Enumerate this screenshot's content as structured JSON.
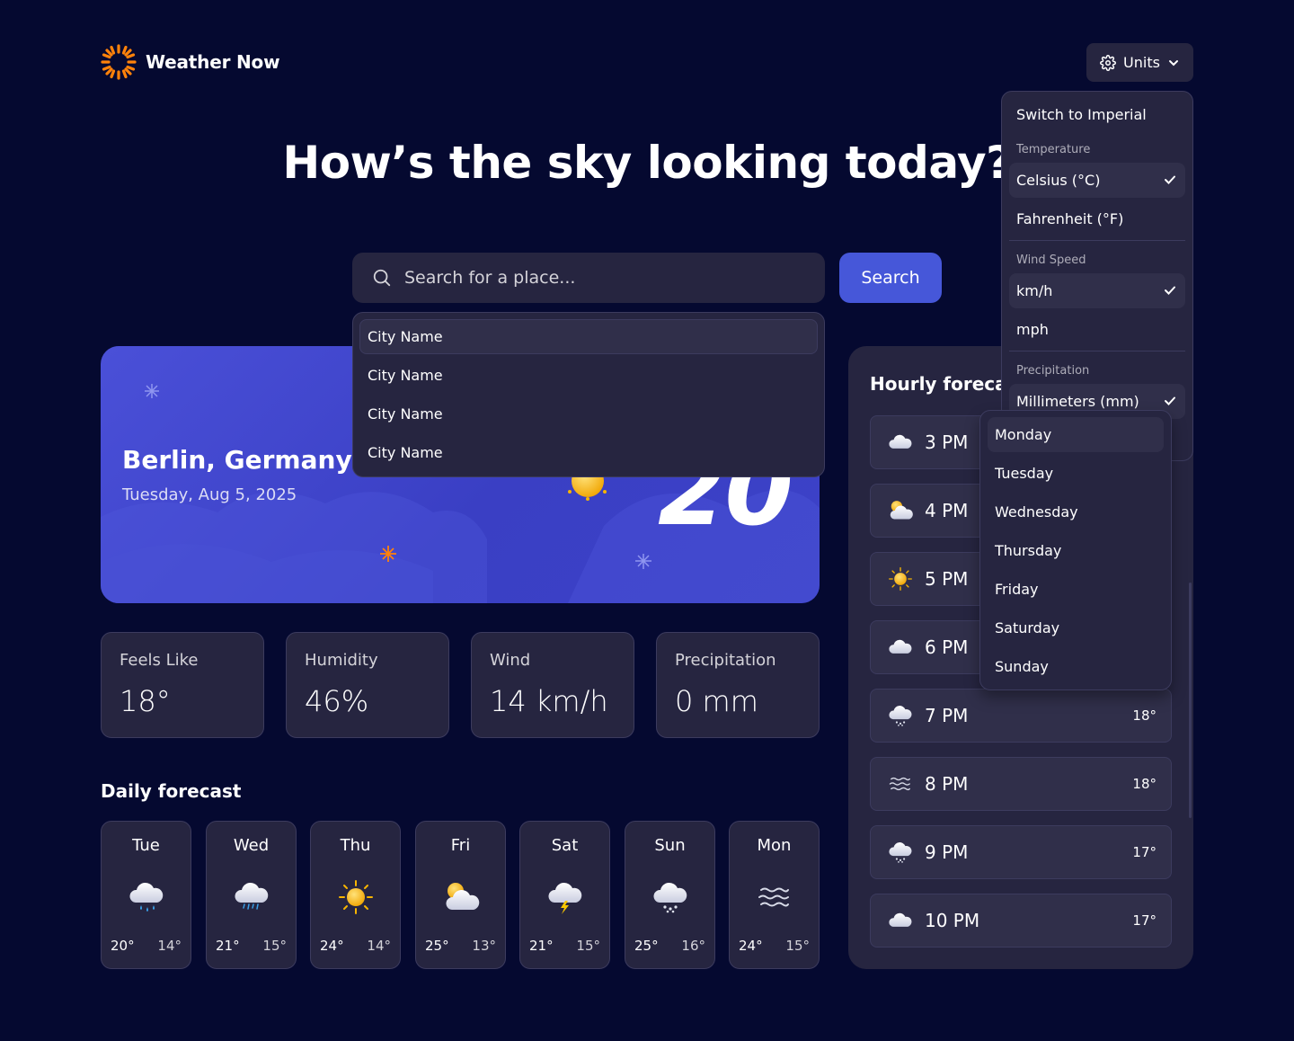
{
  "app": {
    "name": "Weather Now"
  },
  "header": {
    "units_label": "Units"
  },
  "hero": {
    "title": "How’s the sky looking today?"
  },
  "search": {
    "placeholder": "Search for a place...",
    "button_label": "Search",
    "suggestions": [
      "City Name",
      "City Name",
      "City Name",
      "City Name"
    ]
  },
  "current": {
    "location": "Berlin, Germany",
    "date": "Tuesday, Aug 5, 2025",
    "temperature": "20"
  },
  "stats": [
    {
      "label": "Feels Like",
      "value": "18°"
    },
    {
      "label": "Humidity",
      "value": "46%"
    },
    {
      "label": "Wind",
      "value": "14 km/h"
    },
    {
      "label": "Precipitation",
      "value": "0 mm"
    }
  ],
  "daily": {
    "title": "Daily forecast",
    "days": [
      {
        "day": "Tue",
        "icon": "rain-icon",
        "high": "20°",
        "low": "14°"
      },
      {
        "day": "Wed",
        "icon": "drizzle-icon",
        "high": "21°",
        "low": "15°"
      },
      {
        "day": "Thu",
        "icon": "sun-icon",
        "high": "24°",
        "low": "14°"
      },
      {
        "day": "Fri",
        "icon": "partly-cloudy-icon",
        "high": "25°",
        "low": "13°"
      },
      {
        "day": "Sat",
        "icon": "storm-icon",
        "high": "21°",
        "low": "15°"
      },
      {
        "day": "Sun",
        "icon": "snow-icon",
        "high": "25°",
        "low": "16°"
      },
      {
        "day": "Mon",
        "icon": "fog-icon",
        "high": "24°",
        "low": "15°"
      }
    ]
  },
  "hourly": {
    "title": "Hourly forecast",
    "hours": [
      {
        "time": "3 PM",
        "icon": "cloud-icon",
        "temp": ""
      },
      {
        "time": "4 PM",
        "icon": "partly-cloudy-icon",
        "temp": ""
      },
      {
        "time": "5 PM",
        "icon": "sun-icon",
        "temp": ""
      },
      {
        "time": "6 PM",
        "icon": "cloud-icon",
        "temp": ""
      },
      {
        "time": "7 PM",
        "icon": "snow-icon",
        "temp": "18°"
      },
      {
        "time": "8 PM",
        "icon": "fog-icon",
        "temp": "18°"
      },
      {
        "time": "9 PM",
        "icon": "snow-icon",
        "temp": "17°"
      },
      {
        "time": "10 PM",
        "icon": "cloud-icon",
        "temp": "17°"
      }
    ]
  },
  "units_menu": {
    "switch_label": "Switch to Imperial",
    "temperature_heading": "Temperature",
    "celsius": "Celsius (°C)",
    "fahrenheit": "Fahrenheit (°F)",
    "wind_heading": "Wind Speed",
    "kmh": "km/h",
    "mph": "mph",
    "precip_heading": "Precipitation",
    "mm": "Millimeters (mm)"
  },
  "day_menu": {
    "selected": "Monday",
    "options": [
      "Monday",
      "Tuesday",
      "Wednesday",
      "Thursday",
      "Friday",
      "Saturday",
      "Sunday"
    ]
  },
  "colors": {
    "background": "#050930",
    "card": "#262540",
    "accent": "#4657d9",
    "logo": "#ff820a"
  }
}
